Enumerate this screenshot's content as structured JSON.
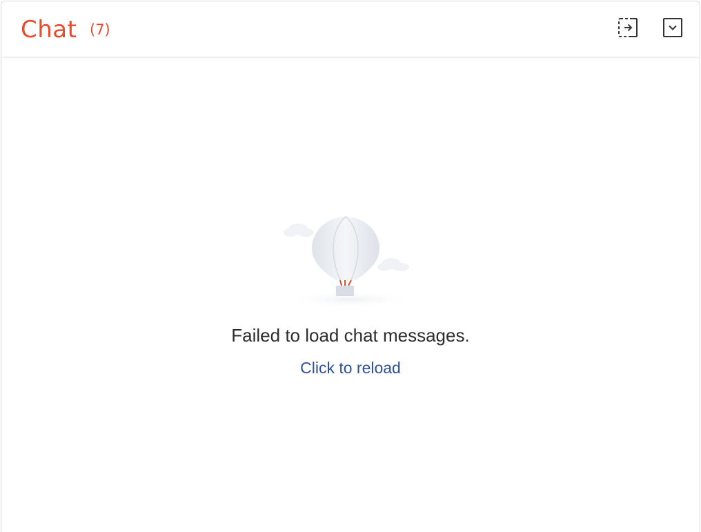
{
  "header": {
    "title": "Chat",
    "count": "(7)",
    "popout_icon": "popout-icon",
    "collapse_icon": "chevron-down-icon"
  },
  "empty_state": {
    "illustration_icon": "hot-air-balloon-icon",
    "message": "Failed to load chat messages.",
    "reload_label": "Click to reload"
  },
  "colors": {
    "brand": "#e84c2b",
    "link": "#2e5199",
    "text": "#2d2d2d"
  }
}
